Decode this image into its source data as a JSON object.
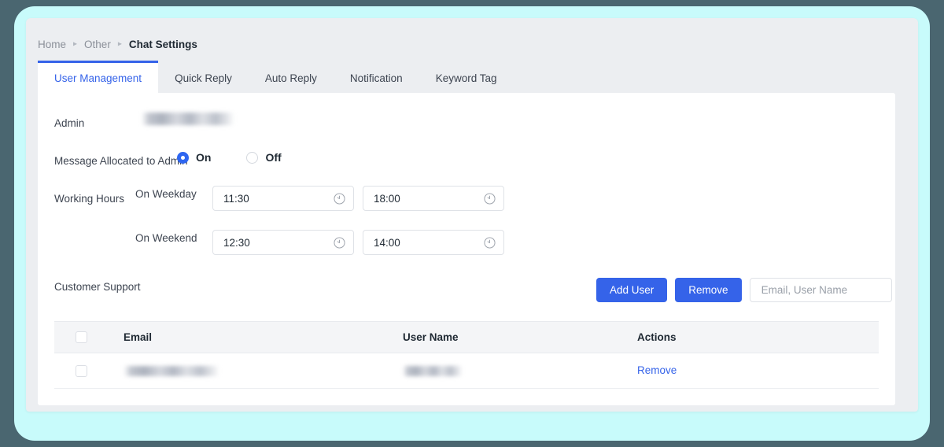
{
  "theme": {
    "outer_bg": "#4a6670",
    "frame_color": "#c8fbfb",
    "panel_bg": "#eceef1",
    "card_bg": "#ffffff",
    "accent_blue": "#3563e9",
    "radio_blue": "#2f66f0",
    "text_primary": "#1f2933",
    "text_muted": "#8b9099",
    "table_head_bg": "#f4f5f7"
  },
  "breadcrumb": {
    "items": [
      {
        "label": "Home",
        "current": false
      },
      {
        "label": "Other",
        "current": false
      },
      {
        "label": "Chat Settings",
        "current": true
      }
    ],
    "separator": "▸"
  },
  "tabs": [
    {
      "label": "User Management",
      "active": true
    },
    {
      "label": "Quick Reply",
      "active": false
    },
    {
      "label": "Auto Reply",
      "active": false
    },
    {
      "label": "Notification",
      "active": false
    },
    {
      "label": "Keyword Tag",
      "active": false
    }
  ],
  "form": {
    "admin": {
      "label": "Admin",
      "value": "",
      "redacted": true
    },
    "message_allocated": {
      "label": "Message Allocated to Admin",
      "options": [
        {
          "label": "On",
          "selected": true
        },
        {
          "label": "Off",
          "selected": false
        }
      ]
    },
    "working_hours": {
      "label": "Working Hours",
      "weekday": {
        "label": "On Weekday",
        "start": "11:30",
        "end": "18:00"
      },
      "weekend": {
        "label": "On Weekend",
        "start": "12:30",
        "end": "14:00"
      },
      "icon": "clock-icon"
    },
    "customer_support": {
      "label": "Customer Support"
    }
  },
  "actions": {
    "add_user_label": "Add User",
    "remove_label": "Remove",
    "search_placeholder": "Email, User Name",
    "search_value": ""
  },
  "table": {
    "columns": [
      "Email",
      "User Name",
      "Actions"
    ],
    "rows": [
      {
        "email": "",
        "user_name": "",
        "email_redacted": true,
        "user_name_redacted": true,
        "action_label": "Remove",
        "checked": false
      }
    ],
    "select_all_checked": false
  }
}
